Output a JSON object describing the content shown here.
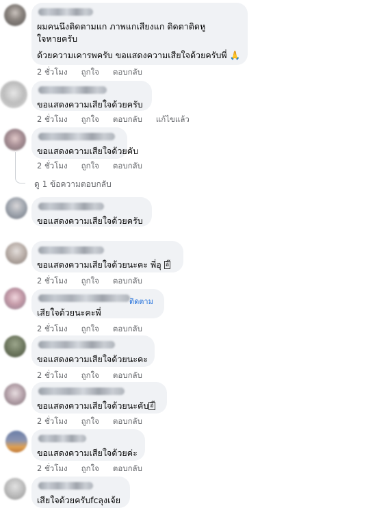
{
  "comments": [
    {
      "lines": [
        "ผมคนนึงติดตามแก ภาพแกเสียงแก ติดตาติดหู",
        "ใจหายครับ"
      ],
      "line2": "ด้วยความเคารพครับ ขอแสดงความเสียใจด้วยครับพี่",
      "emoji": "🙏",
      "time": "2 ชั่วโมง",
      "like": "ถูกใจ",
      "reply": "ตอบกลับ"
    },
    {
      "text": "ขอแสดงความเสียใจด้วยครับ",
      "time": "2 ชั่วโมง",
      "like": "ถูกใจ",
      "reply": "ตอบกลับ",
      "edited": "แก้ไขแล้ว"
    },
    {
      "text": "ขอแสดงความเสียใจด้วยคับ",
      "time": "2 ชั่วโมง",
      "like": "ถูกใจ",
      "reply": "ตอบกลับ",
      "view_replies": "ดู 1 ข้อความตอบกลับ"
    },
    {
      "text": "ขอแสดงความเสียใจด้วยครับ"
    },
    {
      "text": "ขอแสดงความเสียใจด้วยนะคะ พี่อุ",
      "sticker": "อิ๊",
      "time": "2 ชั่วโมง",
      "like": "ถูกใจ",
      "reply": "ตอบกลับ"
    },
    {
      "text": "เสียใจด้วยนะคะพี่",
      "follow": "ติดตาม",
      "time": "2 ชั่วโมง",
      "like": "ถูกใจ",
      "reply": "ตอบกลับ"
    },
    {
      "text": "ขอแสดงความเสียใจด้วยนะคะ",
      "time": "2 ชั่วโมง",
      "like": "ถูกใจ",
      "reply": "ตอบกลับ"
    },
    {
      "text": "ขอแสดงความเสียใจด้วยนะคับ",
      "sticker": "อิ๊",
      "time": "2 ชั่วโมง",
      "like": "ถูกใจ",
      "reply": "ตอบกลับ"
    },
    {
      "text": "ขอแสดงความเสียใจด้วยค่ะ",
      "time": "2 ชั่วโมง",
      "like": "ถูกใจ",
      "reply": "ตอบกลับ"
    },
    {
      "text": "เสียใจด้วยครับfcลุงเจ้ย"
    }
  ]
}
